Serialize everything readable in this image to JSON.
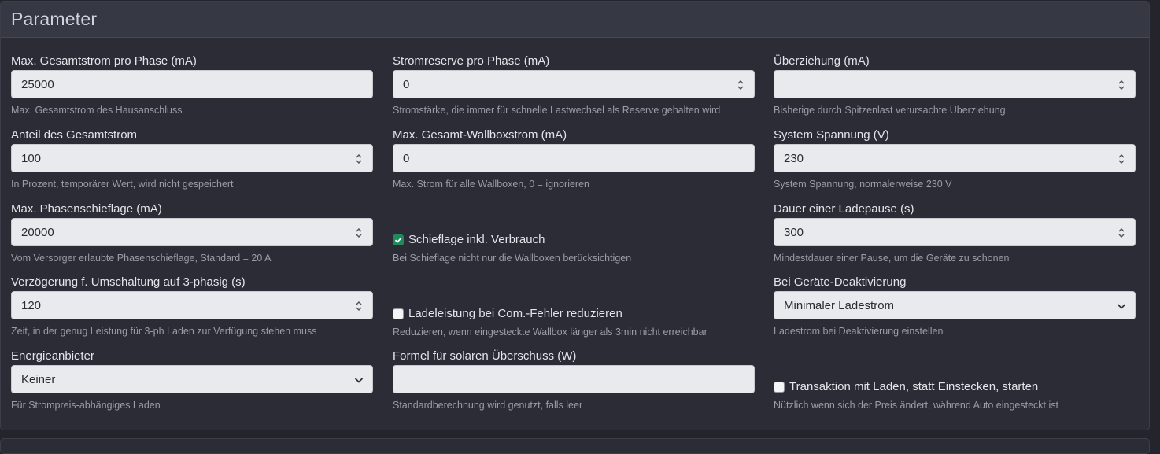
{
  "panel": {
    "title": "Parameter"
  },
  "fields": {
    "max_total_current": {
      "label": "Max. Gesamtstrom pro Phase (mA)",
      "value": "25000",
      "help": "Max. Gesamtstrom des Hausanschluss"
    },
    "current_reserve": {
      "label": "Stromreserve pro Phase (mA)",
      "value": "0",
      "help": "Stromstärke, die immer für schnelle Lastwechsel als Reserve gehalten wird"
    },
    "overdraw": {
      "label": "Überziehung (mA)",
      "value": "",
      "help": "Bisherige durch Spitzenlast verursachte Überziehung"
    },
    "total_current_share": {
      "label": "Anteil des Gesamtstrom",
      "value": "100",
      "help": "In Prozent, temporärer Wert, wird nicht gespeichert"
    },
    "max_wallbox_current": {
      "label": "Max. Gesamt-Wallboxstrom (mA)",
      "value": "0",
      "help": "Max. Strom für alle Wallboxen, 0 = ignorieren"
    },
    "system_voltage": {
      "label": "System Spannung (V)",
      "value": "230",
      "help": "System Spannung, normalerweise 230 V"
    },
    "max_phase_imbalance": {
      "label": "Max. Phasenschieflage (mA)",
      "value": "20000",
      "help": "Vom Versorger erlaubte Phasenschieflage, Standard = 20 A"
    },
    "charge_pause_duration": {
      "label": "Dauer einer Ladepause (s)",
      "value": "300",
      "help": "Mindestdauer einer Pause, um die Geräte zu schonen"
    },
    "three_phase_delay": {
      "label": "Verzögerung f. Umschaltung auf 3-phasig (s)",
      "value": "120",
      "help": "Zeit, in der genug Leistung für 3-ph Laden zur Verfügung stehen muss"
    },
    "device_deactivation": {
      "label": "Bei Geräte-Deaktivierung",
      "value": "Minimaler Ladestrom",
      "help": "Ladestrom bei Deaktivierung einstellen"
    },
    "energy_provider": {
      "label": "Energieanbieter",
      "value": "Keiner",
      "help": "Für Strompreis-abhängiges Laden"
    },
    "solar_formula": {
      "label": "Formel für solaren Überschuss (W)",
      "value": "",
      "help": "Standardberechnung wird genutzt, falls leer"
    }
  },
  "checkboxes": {
    "imbalance_incl_consumption": {
      "label": "Schieflage inkl. Verbrauch",
      "help": "Bei Schieflage nicht nur die Wallboxen berücksichtigen",
      "checked": true
    },
    "reduce_on_com_error": {
      "label": "Ladeleistung bei Com.-Fehler reduzieren",
      "help": "Reduzieren, wenn eingesteckte Wallbox länger als 3min nicht erreichbar",
      "checked": false
    },
    "transaction_on_charge": {
      "label": "Transaktion mit Laden, statt Einstecken, starten",
      "help": "Nützlich wenn sich der Preis ändert, während Auto eingesteckt ist",
      "checked": false
    }
  },
  "icons": {
    "spinner": "spinner-updown-icon",
    "select": "chevron-down-icon",
    "check": "checkmark-icon"
  },
  "colors": {
    "accent_check": "#1f8a5b",
    "panel_bg": "#2b2c36",
    "header_bg": "#363944",
    "input_bg": "#e9eaee"
  }
}
